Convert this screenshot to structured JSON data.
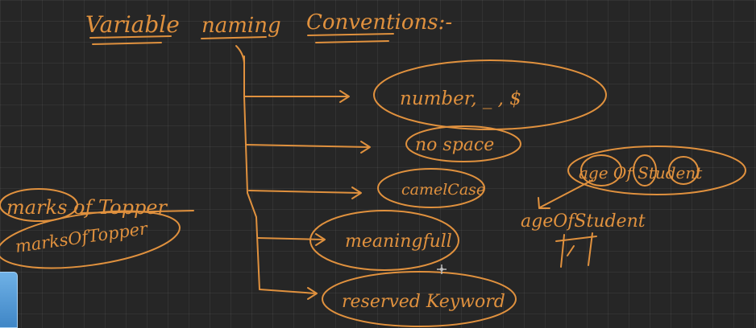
{
  "title": {
    "word1": "Variable",
    "word2": "naming",
    "word3": "Conventions:-"
  },
  "rules": [
    {
      "text": "number, _ , $"
    },
    {
      "text": "no space"
    },
    {
      "text": "camelCase"
    },
    {
      "text": "meaningfull"
    },
    {
      "text": "reserved Keyword"
    }
  ],
  "left_example": {
    "spaced": "marks of Topper",
    "camel": "marksOfTopper"
  },
  "right_example": {
    "spaced": "age Of Student",
    "camel": "ageOfStudent"
  },
  "colors": {
    "ink": "#e0913e",
    "board": "#262626"
  }
}
